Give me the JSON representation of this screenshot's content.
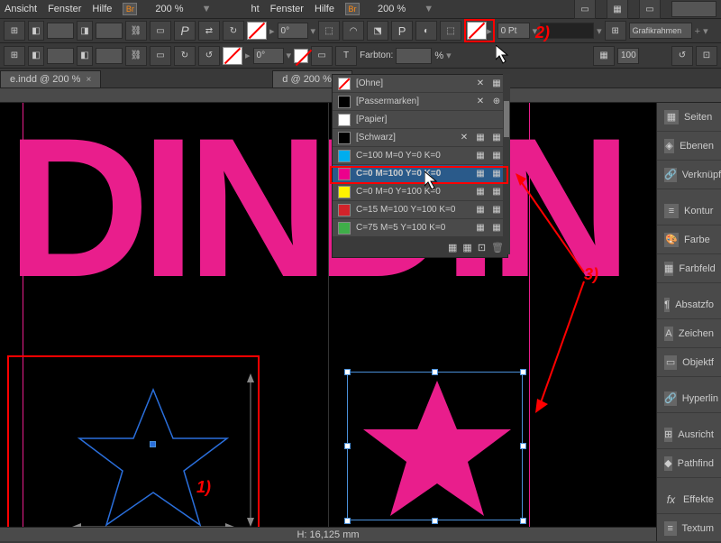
{
  "menu": {
    "ansicht": "Ansicht",
    "fenster": "Fenster",
    "hilfe": "Hilfe",
    "br": "Br",
    "zoom": "200 %",
    "ht": "ht"
  },
  "toolbar": {
    "deg": "0°",
    "pt": "0 Pt",
    "gfxframe": "Grafikrahmen",
    "px100": "100",
    "farbton": "Farbton:",
    "pct": "%"
  },
  "tabs": {
    "t1": "e.indd @ 200 %",
    "t2": "d @ 200 %"
  },
  "swatches": [
    {
      "name": "[Ohne]",
      "chip": "none",
      "icons": [
        "✕",
        "▦"
      ]
    },
    {
      "name": "[Passermarken]",
      "chip": "#000",
      "icons": [
        "✕",
        "⊕"
      ]
    },
    {
      "name": "[Papier]",
      "chip": "#fff",
      "icons": []
    },
    {
      "name": "[Schwarz]",
      "chip": "#000",
      "icons": [
        "✕",
        "▦",
        "▦"
      ]
    },
    {
      "name": "C=100 M=0 Y=0 K=0",
      "chip": "#00adee",
      "icons": [
        "▦",
        "▦"
      ]
    },
    {
      "name": "C=0 M=100 Y=0 K=0",
      "chip": "#ec008c",
      "icons": [
        "▦",
        "▦"
      ],
      "selected": true
    },
    {
      "name": "C=0 M=0 Y=100 K=0",
      "chip": "#fff200",
      "icons": [
        "▦",
        "▦"
      ]
    },
    {
      "name": "C=15 M=100 Y=100 K=0",
      "chip": "#d2232a",
      "icons": [
        "▦",
        "▦"
      ]
    },
    {
      "name": "C=75 M=5 Y=100 K=0",
      "chip": "#3fae49",
      "icons": [
        "▦",
        "▦"
      ]
    }
  ],
  "rightPanel": {
    "items": [
      "Seiten",
      "Ebenen",
      "Verknüpf",
      "Kontur",
      "Farbe",
      "Farbfeld",
      "Absatzfo",
      "Zeichen",
      "Objektf",
      "Hyperlin",
      "Ausricht",
      "Pathfind",
      "Effekte",
      "Textum"
    ]
  },
  "status": {
    "h": "H: 16,125 mm"
  },
  "annot": {
    "a1": "1)",
    "a2": "2)",
    "a3": "3)"
  },
  "colors": {
    "pink": "#e91e8c"
  }
}
